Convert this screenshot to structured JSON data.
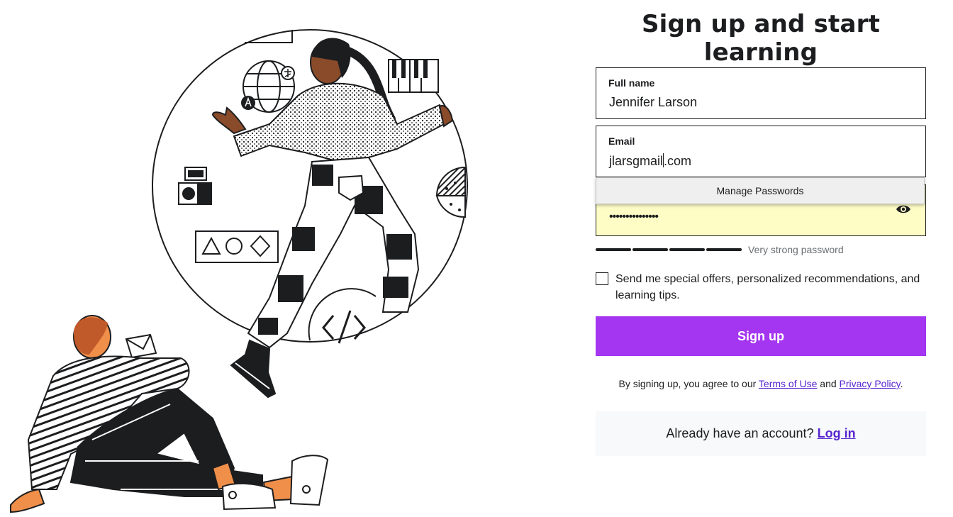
{
  "heading": "Sign up and start learning",
  "fields": {
    "full_name": {
      "label": "Full name",
      "value": "Jennifer Larson"
    },
    "email": {
      "label": "Email",
      "value_before_caret": "jlarsgmail",
      "value_after_caret": ".com"
    },
    "password": {
      "value": "•••••••••••••••"
    }
  },
  "autofill_dropdown": {
    "label": "Manage Passwords"
  },
  "password_strength": {
    "text": "Very strong password",
    "level_fraction": 1.0
  },
  "offers_checkbox": {
    "checked": false,
    "label": "Send me special offers, personalized recommendations, and learning tips."
  },
  "signup_button": {
    "label": "Sign up"
  },
  "terms": {
    "prefix": "By signing up, you agree to our ",
    "terms_link": "Terms of Use",
    "middle": " and ",
    "privacy_link": "Privacy Policy",
    "suffix": "."
  },
  "login": {
    "prompt": "Already have an account? ",
    "link": "Log in"
  },
  "colors": {
    "accent": "#a435f0",
    "link": "#5624d0",
    "autofill_bg": "#fffdc6",
    "skin": "#f08f4a"
  },
  "illustration": {
    "icons": [
      "globe-icon",
      "piano-keys-icon",
      "camera-icon",
      "shapes-icon",
      "code-icon",
      "envelope-icon"
    ]
  }
}
